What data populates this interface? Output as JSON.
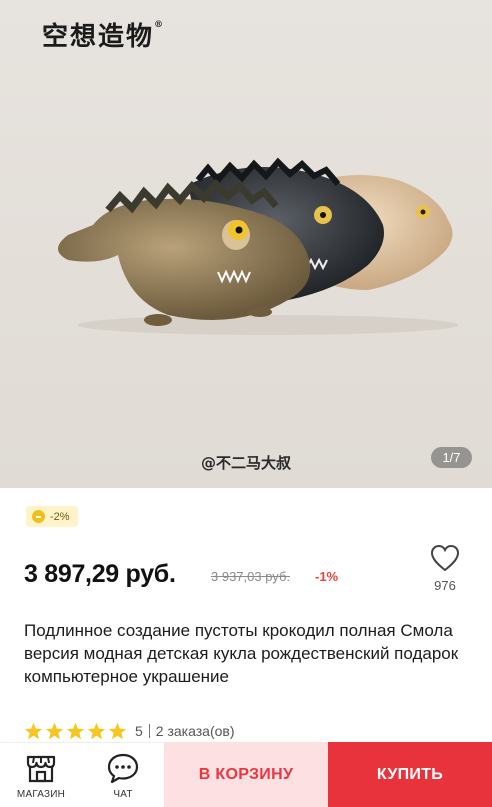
{
  "gallery": {
    "brand": "空想造物",
    "brand_mark": "®",
    "watermark": "@不二马大叔",
    "counter": "1/7"
  },
  "promo": {
    "discount": "-2%"
  },
  "pricing": {
    "price": "3 897,29 руб.",
    "old_price": "3 937,03 руб.",
    "discount": "-1%"
  },
  "wishlist": {
    "count": "976",
    "icon": "heart-icon"
  },
  "product": {
    "title": "Подлинное создание пустоты крокодил полная Смола версия модная детская кукла рождественский подарок компьютерное украшение"
  },
  "rating": {
    "stars": 5,
    "score": "5",
    "orders": "2 заказа(ов)",
    "star_color": "#f6c623"
  },
  "bottom_bar": {
    "store_label": "МАГАЗИН",
    "chat_label": "ЧАТ",
    "cart_label": "В КОРЗИНУ",
    "buy_label": "КУПИТЬ"
  },
  "colors": {
    "accent": "#e9333c",
    "cart_bg": "#fde0e1",
    "discount_red": "#e8453c"
  }
}
